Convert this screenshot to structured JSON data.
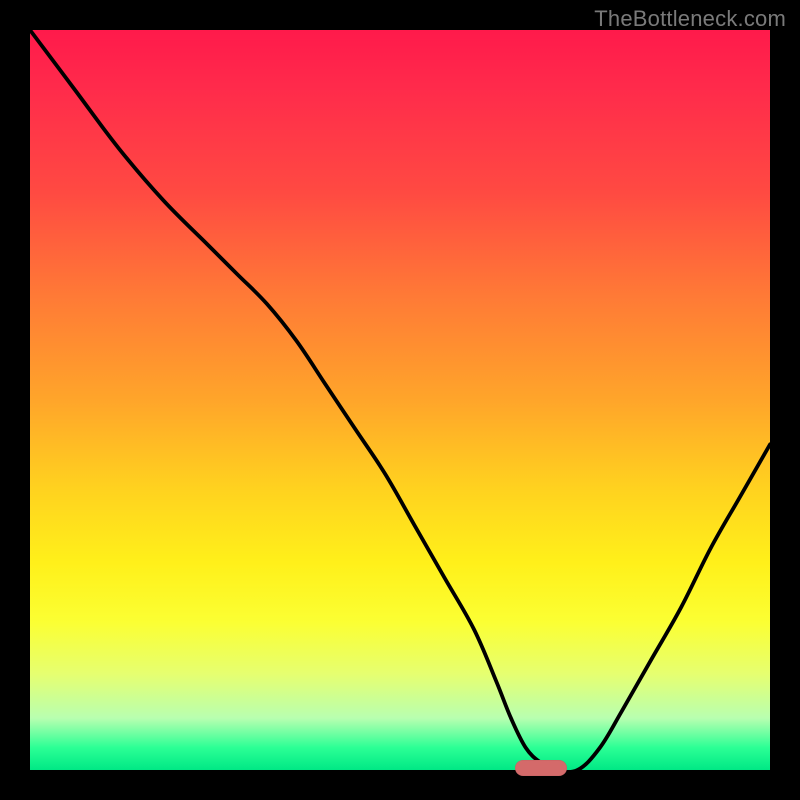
{
  "watermark": "TheBottleneck.com",
  "colors": {
    "curve_stroke": "#000000",
    "pill_fill": "#d46a6a"
  },
  "chart_data": {
    "type": "line",
    "title": "",
    "xlabel": "",
    "ylabel": "",
    "xlim": [
      0,
      100
    ],
    "ylim": [
      0,
      100
    ],
    "x": [
      0,
      6,
      12,
      18,
      24,
      28,
      32,
      36,
      40,
      44,
      48,
      52,
      56,
      60,
      63,
      65,
      67,
      69,
      71,
      74,
      77,
      80,
      84,
      88,
      92,
      96,
      100
    ],
    "values": [
      100,
      92,
      84,
      77,
      71,
      67,
      63,
      58,
      52,
      46,
      40,
      33,
      26,
      19,
      12,
      7,
      3,
      1,
      0,
      0,
      3,
      8,
      15,
      22,
      30,
      37,
      44
    ],
    "marker": {
      "x": 69,
      "y": 0,
      "shape": "pill"
    },
    "grid": false,
    "legend": false
  }
}
